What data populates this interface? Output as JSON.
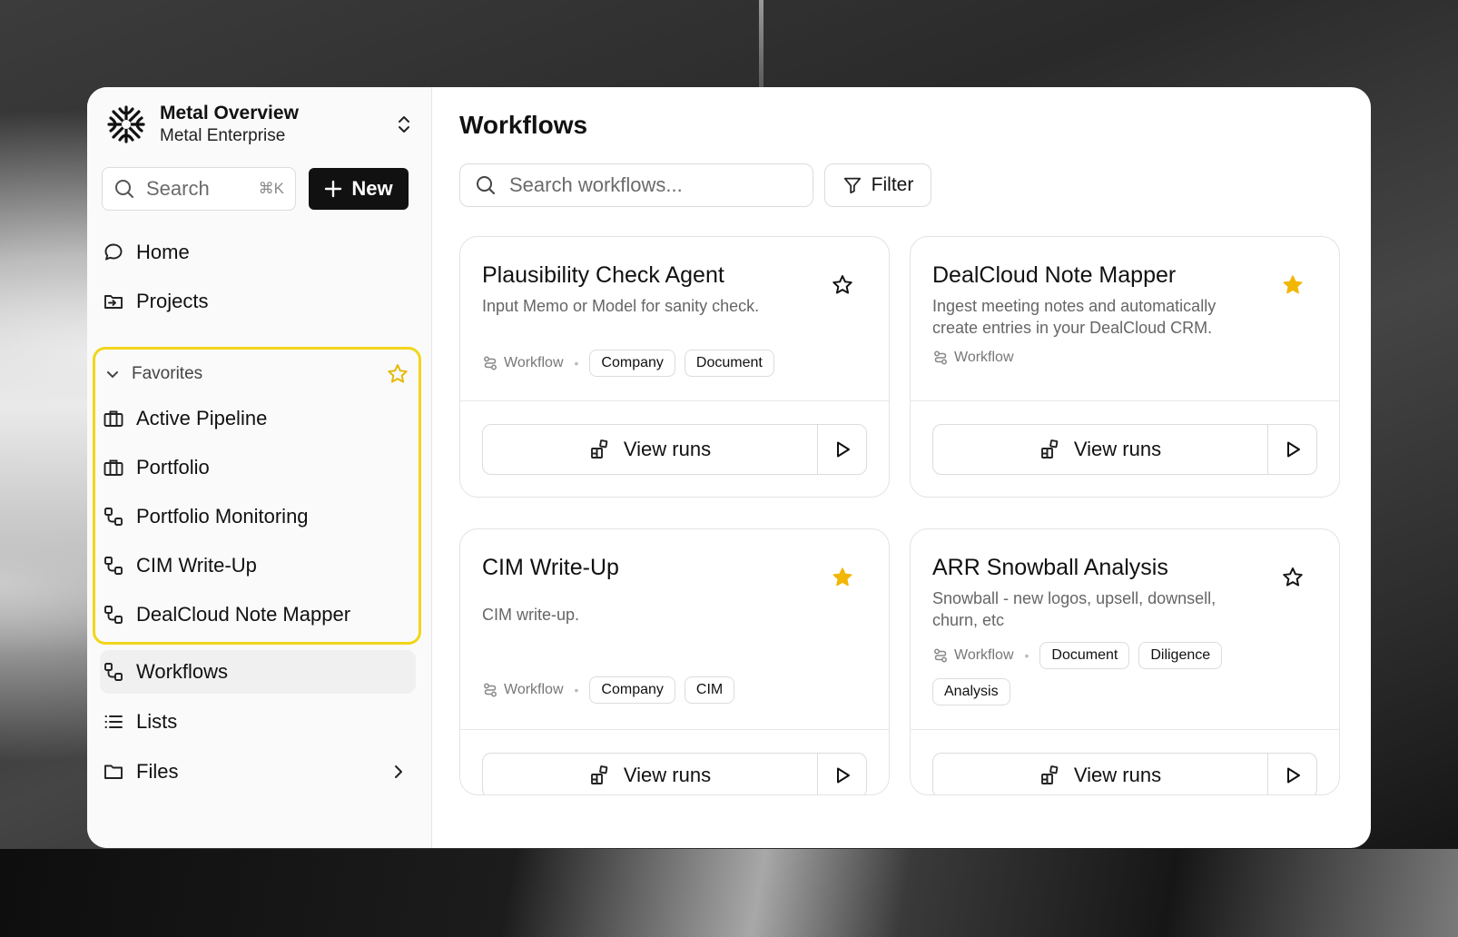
{
  "colors": {
    "accent_yellow": "#f2d51a",
    "star_filled": "#f2b705",
    "primary_button": "#111111"
  },
  "org": {
    "title": "Metal Overview",
    "subtitle": "Metal Enterprise"
  },
  "sidebar": {
    "search_placeholder": "Search",
    "search_shortcut": "⌘K",
    "new_label": "New",
    "nav_top": [
      {
        "label": "Home",
        "icon": "chat-bubble-icon"
      },
      {
        "label": "Projects",
        "icon": "folder-arrow-icon"
      }
    ],
    "favorites": {
      "label": "Favorites",
      "items": [
        {
          "label": "Active Pipeline",
          "icon": "briefcase-icon"
        },
        {
          "label": "Portfolio",
          "icon": "briefcase-icon"
        },
        {
          "label": "Portfolio Monitoring",
          "icon": "workflow-icon"
        },
        {
          "label": "CIM Write-Up",
          "icon": "workflow-icon"
        },
        {
          "label": "DealCloud Note Mapper",
          "icon": "workflow-icon"
        }
      ]
    },
    "nav_bottom": [
      {
        "label": "Workflows",
        "icon": "workflow-icon",
        "active": true
      },
      {
        "label": "Lists",
        "icon": "list-icon"
      },
      {
        "label": "Files",
        "icon": "folder-icon"
      }
    ]
  },
  "main": {
    "title": "Workflows",
    "search_placeholder": "Search workflows...",
    "filter_label": "Filter",
    "cards": [
      {
        "title": "Plausibility Check Agent",
        "description": "Input Memo or Model for sanity check.",
        "type": "Workflow",
        "tags": [
          "Company",
          "Document"
        ],
        "favorited": false,
        "view_runs": "View runs"
      },
      {
        "title": "DealCloud Note Mapper",
        "description": "Ingest meeting notes and automatically create entries in your DealCloud CRM.",
        "type": "Workflow",
        "tags": [],
        "favorited": true,
        "view_runs": "View runs"
      },
      {
        "title": "CIM Write-Up",
        "description": "CIM write-up.",
        "type": "Workflow",
        "tags": [
          "Company",
          "CIM"
        ],
        "favorited": true,
        "view_runs": "View runs"
      },
      {
        "title": "ARR Snowball Analysis",
        "description": "Snowball - new logos, upsell, downsell, churn, etc",
        "type": "Workflow",
        "tags": [
          "Document",
          "Diligence",
          "Analysis"
        ],
        "favorited": false,
        "view_runs": "View runs"
      }
    ]
  }
}
